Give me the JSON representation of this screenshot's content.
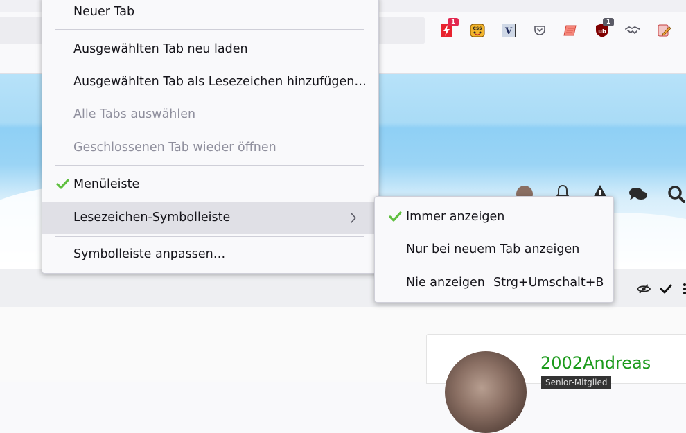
{
  "extensions": [
    {
      "name": "flash-extension-icon",
      "badge": "1",
      "badge_color": "#e22850"
    },
    {
      "name": "css-extension-icon"
    },
    {
      "name": "v-extension-icon",
      "letter": "V"
    },
    {
      "name": "pocket-icon"
    },
    {
      "name": "scroll-extension-icon"
    },
    {
      "name": "ublock-icon",
      "badge": "1",
      "badge_color": "#5b5b66"
    },
    {
      "name": "handshake-icon"
    },
    {
      "name": "edit-extension-icon"
    }
  ],
  "context_menu": {
    "items": [
      {
        "label": "Neuer Tab"
      },
      {
        "label": "Ausgewählten Tab neu laden"
      },
      {
        "label": "Ausgewählten Tab als Lesezeichen hinzufügen…"
      },
      {
        "label": "Alle Tabs auswählen",
        "disabled": true
      },
      {
        "label": "Geschlossenen Tab wieder öffnen",
        "disabled": true
      },
      {
        "label": "Menüleiste",
        "checked": true
      },
      {
        "label": "Lesezeichen-Symbolleiste",
        "submenu": true,
        "active": true
      },
      {
        "label": "Symbolleiste anpassen…"
      }
    ]
  },
  "submenu": {
    "items": [
      {
        "label": "Immer anzeigen",
        "checked": true
      },
      {
        "label": "Nur bei neuem Tab anzeigen"
      },
      {
        "label": "Nie anzeigen",
        "shortcut": "Strg+Umschalt+B"
      }
    ]
  },
  "profile": {
    "username": "2002Andreas",
    "rank": "Senior-Mitglied"
  },
  "colors": {
    "accent_green": "#1b9a1b",
    "check_green": "#5fbf3f",
    "menu_background": "#f9f9fb",
    "active_item": "#e0e0e6"
  }
}
